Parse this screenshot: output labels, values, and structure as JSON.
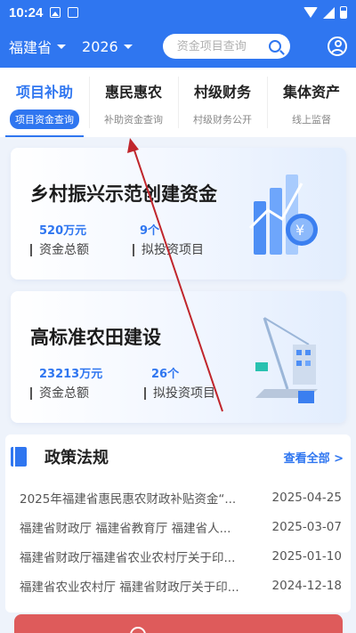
{
  "status": {
    "time": "10:24"
  },
  "header": {
    "province": "福建省",
    "year": "2026",
    "search_placeholder": "资金项目查询"
  },
  "tabs": [
    {
      "label": "项目补助",
      "sub": "项目资金查询"
    },
    {
      "label": "惠民惠农",
      "sub": "补助资金查询"
    },
    {
      "label": "村级财务",
      "sub": "村级财务公开"
    },
    {
      "label": "集体资产",
      "sub": "线上监督"
    }
  ],
  "cards": [
    {
      "title": "乡村振兴示范创建资金",
      "amount": "520万元",
      "count": "9个",
      "amount_label": "资金总额",
      "count_label": "拟投资项目"
    },
    {
      "title": "高标准农田建设",
      "amount": "23213万元",
      "count": "26个",
      "amount_label": "资金总额",
      "count_label": "拟投资项目"
    }
  ],
  "policy": {
    "title": "政策法规",
    "more": "查看全部 >",
    "items": [
      {
        "text": "2025年福建省惠民惠农财政补贴资金“...",
        "date": "2025-04-25"
      },
      {
        "text": "福建省财政厅 福建省教育厅 福建省人...",
        "date": "2025-03-07"
      },
      {
        "text": "福建省财政厅福建省农业农村厅关于印...",
        "date": "2025-01-10"
      },
      {
        "text": "福建省农业农村厅 福建省财政厅关于印...",
        "date": "2024-12-18"
      }
    ]
  },
  "colors": {
    "primary": "#2f76f0",
    "bottom_button": "#de5b5b",
    "annotation_arrow": "#c0262c"
  }
}
